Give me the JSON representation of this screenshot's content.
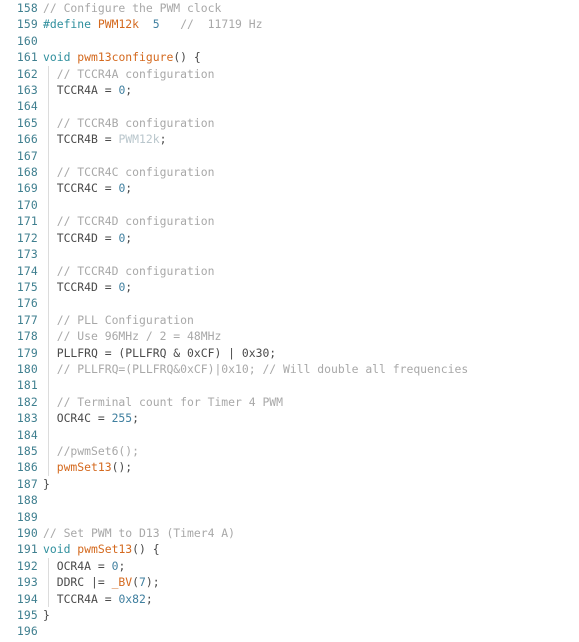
{
  "editor": {
    "name": "code-editor-pane",
    "language": "C++ (Arduino)",
    "background_color": "#ffffff",
    "line_number_color": "#3f7f8f",
    "comment_color": "#a8a8a8",
    "keyword_color": "#2f8f9d",
    "function_color": "#d4691e",
    "number_color": "#3f7f9f",
    "plain_color": "#3c4043",
    "indent_guide_color": "#dcdcdc",
    "first_line_number": 158,
    "last_line_number": 196,
    "lines": [
      {
        "num": "158",
        "indent_guide": false,
        "tokens": [
          {
            "t": "// Configure the PWM clock",
            "c": "t-com"
          }
        ]
      },
      {
        "num": "159",
        "indent_guide": false,
        "tokens": [
          {
            "t": "#define",
            "c": "t-mac"
          },
          {
            "t": " ",
            "c": "t-pln"
          },
          {
            "t": "PWM12k",
            "c": "t-id"
          },
          {
            "t": "  ",
            "c": "t-pln"
          },
          {
            "t": "5",
            "c": "t-num"
          },
          {
            "t": "   ",
            "c": "t-pln"
          },
          {
            "t": "//  11719 Hz",
            "c": "t-com"
          }
        ]
      },
      {
        "num": "160",
        "indent_guide": false,
        "tokens": []
      },
      {
        "num": "161",
        "indent_guide": false,
        "tokens": [
          {
            "t": "void",
            "c": "t-kw"
          },
          {
            "t": " ",
            "c": "t-pln"
          },
          {
            "t": "pwm13configure",
            "c": "t-fn"
          },
          {
            "t": "() {",
            "c": "t-pln"
          }
        ]
      },
      {
        "num": "162",
        "indent_guide": true,
        "tokens": [
          {
            "t": "  // TCCR4A configuration",
            "c": "t-com"
          }
        ]
      },
      {
        "num": "163",
        "indent_guide": true,
        "tokens": [
          {
            "t": "  TCCR4A = ",
            "c": "t-pln"
          },
          {
            "t": "0",
            "c": "t-num"
          },
          {
            "t": ";",
            "c": "t-pln"
          }
        ]
      },
      {
        "num": "164",
        "indent_guide": true,
        "tokens": []
      },
      {
        "num": "165",
        "indent_guide": true,
        "tokens": [
          {
            "t": "  // TCCR4B configuration",
            "c": "t-com"
          }
        ]
      },
      {
        "num": "166",
        "indent_guide": true,
        "tokens": [
          {
            "t": "  TCCR4B = ",
            "c": "t-pln"
          },
          {
            "t": "PWM12k",
            "c": "t-dim"
          },
          {
            "t": ";",
            "c": "t-pln"
          }
        ]
      },
      {
        "num": "167",
        "indent_guide": true,
        "tokens": []
      },
      {
        "num": "168",
        "indent_guide": true,
        "tokens": [
          {
            "t": "  // TCCR4C configuration",
            "c": "t-com"
          }
        ]
      },
      {
        "num": "169",
        "indent_guide": true,
        "tokens": [
          {
            "t": "  TCCR4C = ",
            "c": "t-pln"
          },
          {
            "t": "0",
            "c": "t-num"
          },
          {
            "t": ";",
            "c": "t-pln"
          }
        ]
      },
      {
        "num": "170",
        "indent_guide": true,
        "tokens": []
      },
      {
        "num": "171",
        "indent_guide": true,
        "tokens": [
          {
            "t": "  // TCCR4D configuration",
            "c": "t-com"
          }
        ]
      },
      {
        "num": "172",
        "indent_guide": true,
        "tokens": [
          {
            "t": "  TCCR4D = ",
            "c": "t-pln"
          },
          {
            "t": "0",
            "c": "t-num"
          },
          {
            "t": ";",
            "c": "t-pln"
          }
        ]
      },
      {
        "num": "173",
        "indent_guide": true,
        "tokens": []
      },
      {
        "num": "174",
        "indent_guide": true,
        "tokens": [
          {
            "t": "  // TCCR4D configuration",
            "c": "t-com"
          }
        ]
      },
      {
        "num": "175",
        "indent_guide": true,
        "tokens": [
          {
            "t": "  TCCR4D = ",
            "c": "t-pln"
          },
          {
            "t": "0",
            "c": "t-num"
          },
          {
            "t": ";",
            "c": "t-pln"
          }
        ]
      },
      {
        "num": "176",
        "indent_guide": true,
        "tokens": []
      },
      {
        "num": "177",
        "indent_guide": true,
        "tokens": [
          {
            "t": "  // PLL Configuration",
            "c": "t-com"
          }
        ]
      },
      {
        "num": "178",
        "indent_guide": true,
        "tokens": [
          {
            "t": "  // Use 96MHz / 2 = 48MHz",
            "c": "t-com"
          }
        ]
      },
      {
        "num": "179",
        "indent_guide": true,
        "tokens": [
          {
            "t": "  PLLFRQ = (PLLFRQ & 0xCF) | 0x30;",
            "c": "t-pln"
          }
        ]
      },
      {
        "num": "180",
        "indent_guide": true,
        "tokens": [
          {
            "t": "  // PLLFRQ=(PLLFRQ&0xCF)|0x10; // Will double all frequencies",
            "c": "t-com"
          }
        ]
      },
      {
        "num": "181",
        "indent_guide": true,
        "tokens": []
      },
      {
        "num": "182",
        "indent_guide": true,
        "tokens": [
          {
            "t": "  // Terminal count for Timer 4 PWM",
            "c": "t-com"
          }
        ]
      },
      {
        "num": "183",
        "indent_guide": true,
        "tokens": [
          {
            "t": "  OCR4C = ",
            "c": "t-pln"
          },
          {
            "t": "255",
            "c": "t-num"
          },
          {
            "t": ";",
            "c": "t-pln"
          }
        ]
      },
      {
        "num": "184",
        "indent_guide": true,
        "tokens": []
      },
      {
        "num": "185",
        "indent_guide": true,
        "tokens": [
          {
            "t": "  //pwmSet6();",
            "c": "t-com"
          }
        ]
      },
      {
        "num": "186",
        "indent_guide": true,
        "tokens": [
          {
            "t": "  ",
            "c": "t-pln"
          },
          {
            "t": "pwmSet13",
            "c": "t-fn"
          },
          {
            "t": "();",
            "c": "t-pln"
          }
        ]
      },
      {
        "num": "187",
        "indent_guide": false,
        "tokens": [
          {
            "t": "}",
            "c": "t-pln"
          }
        ]
      },
      {
        "num": "188",
        "indent_guide": false,
        "tokens": []
      },
      {
        "num": "189",
        "indent_guide": false,
        "tokens": []
      },
      {
        "num": "190",
        "indent_guide": false,
        "tokens": [
          {
            "t": "// Set PWM to D13 (Timer4 A)",
            "c": "t-com"
          }
        ]
      },
      {
        "num": "191",
        "indent_guide": false,
        "tokens": [
          {
            "t": "void",
            "c": "t-kw"
          },
          {
            "t": " ",
            "c": "t-pln"
          },
          {
            "t": "pwmSet13",
            "c": "t-fn"
          },
          {
            "t": "() {",
            "c": "t-pln"
          }
        ]
      },
      {
        "num": "192",
        "indent_guide": true,
        "tokens": [
          {
            "t": "  OCR4A = ",
            "c": "t-pln"
          },
          {
            "t": "0",
            "c": "t-num"
          },
          {
            "t": ";",
            "c": "t-pln"
          }
        ]
      },
      {
        "num": "193",
        "indent_guide": true,
        "tokens": [
          {
            "t": "  DDRC |= ",
            "c": "t-pln"
          },
          {
            "t": "_BV",
            "c": "t-fn"
          },
          {
            "t": "(",
            "c": "t-pln"
          },
          {
            "t": "7",
            "c": "t-num"
          },
          {
            "t": ");",
            "c": "t-pln"
          }
        ]
      },
      {
        "num": "194",
        "indent_guide": true,
        "tokens": [
          {
            "t": "  TCCR4A = ",
            "c": "t-pln"
          },
          {
            "t": "0x82",
            "c": "t-num"
          },
          {
            "t": ";",
            "c": "t-pln"
          }
        ]
      },
      {
        "num": "195",
        "indent_guide": false,
        "tokens": [
          {
            "t": "}",
            "c": "t-pln"
          }
        ]
      },
      {
        "num": "196",
        "indent_guide": false,
        "tokens": []
      }
    ]
  }
}
